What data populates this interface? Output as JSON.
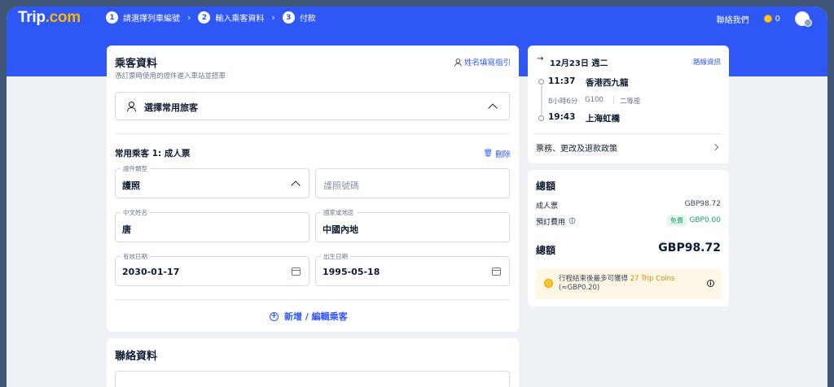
{
  "brand": {
    "logo_text": "Trip",
    "logo_suffix": ".com"
  },
  "steps": [
    {
      "num": "1",
      "label": "請選擇列車編號"
    },
    {
      "num": "2",
      "label": "輸入乘客資料"
    },
    {
      "num": "3",
      "label": "付款"
    }
  ],
  "header": {
    "contact_label": "聯絡我們",
    "coins": "0"
  },
  "passenger": {
    "title": "乘客資料",
    "subtitle": "憑訂票時使用的證件進入車站並搭車",
    "name_guide_link": "姓名填寫指引",
    "select_frequent": "選擇常用旅客",
    "entry_title": "常用乘客 1: 成人票",
    "delete_label": "刪除",
    "fields": {
      "doc_type": {
        "label": "證件類型",
        "value": "護照"
      },
      "passport_no": {
        "placeholder": "護照號碼"
      },
      "chinese_name": {
        "label": "中文姓名",
        "value": "唐"
      },
      "country": {
        "label": "國家或地區",
        "value": "中國內地"
      },
      "expiry": {
        "label": "有效日期",
        "value": "2030-01-17"
      },
      "birth": {
        "label": "出生日期",
        "value": "1995-05-18"
      }
    },
    "add_edit_label": "新增 / 編輯乘客"
  },
  "contact": {
    "title": "聯絡資料"
  },
  "trip": {
    "date": "12月23日 週二",
    "route_info_link": "路線資訊",
    "depart_time": "11:37",
    "depart_station": "香港西九龍",
    "duration": "8小時6分",
    "train_no": "G100",
    "seat_class": "二等座",
    "arrive_time": "19:43",
    "arrive_station": "上海虹橋",
    "policy_link": "票務、更改及退款政策"
  },
  "total": {
    "title": "總額",
    "adult_label": "成人票",
    "adult_price": "GBP98.72",
    "booking_fee_label": "預訂費用",
    "free_label": "免費",
    "booking_fee_price": "GBP0.00",
    "total_label": "總額",
    "total_price": "GBP98.72",
    "coins_prefix": "行程結束後最多可獲得",
    "coins_amount": "27 Trip Coins",
    "coins_value": "(≈GBP0.20)"
  },
  "colors": {
    "brand_blue": "#2f57f5",
    "coin_gold": "#ffc52e"
  }
}
